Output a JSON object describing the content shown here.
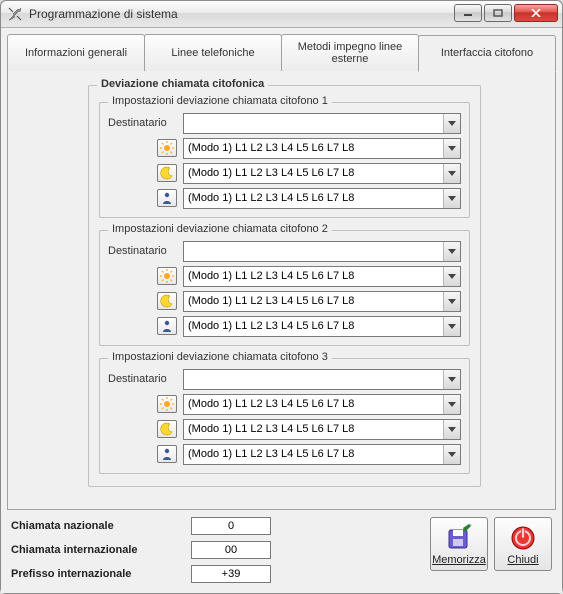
{
  "window": {
    "title": "Programmazione di sistema"
  },
  "tabs": {
    "items": [
      {
        "label": "Informazioni generali"
      },
      {
        "label": "Linee telefoniche"
      },
      {
        "label": "Metodi impegno linee esterne"
      },
      {
        "label": "Interfaccia citofono"
      }
    ],
    "active_index": 3
  },
  "deviation": {
    "title": "Deviazione chiamata citofonica",
    "groups": [
      {
        "legend": "Impostazioni deviazione chiamata citofono 1",
        "destinatario_label": "Destinatario",
        "destinatario_value": "",
        "modes": [
          {
            "icon": "sun-icon",
            "value": "(Modo 1) L1 L2 L3 L4 L5 L6 L7 L8"
          },
          {
            "icon": "moon-icon",
            "value": "(Modo 1) L1 L2 L3 L4 L5 L6 L7 L8"
          },
          {
            "icon": "person-icon",
            "value": "(Modo 1) L1 L2 L3 L4 L5 L6 L7 L8"
          }
        ]
      },
      {
        "legend": "Impostazioni deviazione chiamata citofono 2",
        "destinatario_label": "Destinatario",
        "destinatario_value": "",
        "modes": [
          {
            "icon": "sun-icon",
            "value": "(Modo 1) L1 L2 L3 L4 L5 L6 L7 L8"
          },
          {
            "icon": "moon-icon",
            "value": "(Modo 1) L1 L2 L3 L4 L5 L6 L7 L8"
          },
          {
            "icon": "person-icon",
            "value": "(Modo 1) L1 L2 L3 L4 L5 L6 L7 L8"
          }
        ]
      },
      {
        "legend": "Impostazioni deviazione chiamata citofono 3",
        "destinatario_label": "Destinatario",
        "destinatario_value": "",
        "modes": [
          {
            "icon": "sun-icon",
            "value": "(Modo 1) L1 L2 L3 L4 L5 L6 L7 L8"
          },
          {
            "icon": "moon-icon",
            "value": "(Modo 1) L1 L2 L3 L4 L5 L6 L7 L8"
          },
          {
            "icon": "person-icon",
            "value": "(Modo 1) L1 L2 L3 L4 L5 L6 L7 L8"
          }
        ]
      }
    ]
  },
  "footer": {
    "national_label": "Chiamata nazionale",
    "national_value": "0",
    "international_label": "Chiamata internazionale",
    "international_value": "00",
    "prefix_label": "Prefisso internazionale",
    "prefix_value": "+39",
    "save_label": "Memorizza",
    "close_label": "Chiudi"
  }
}
